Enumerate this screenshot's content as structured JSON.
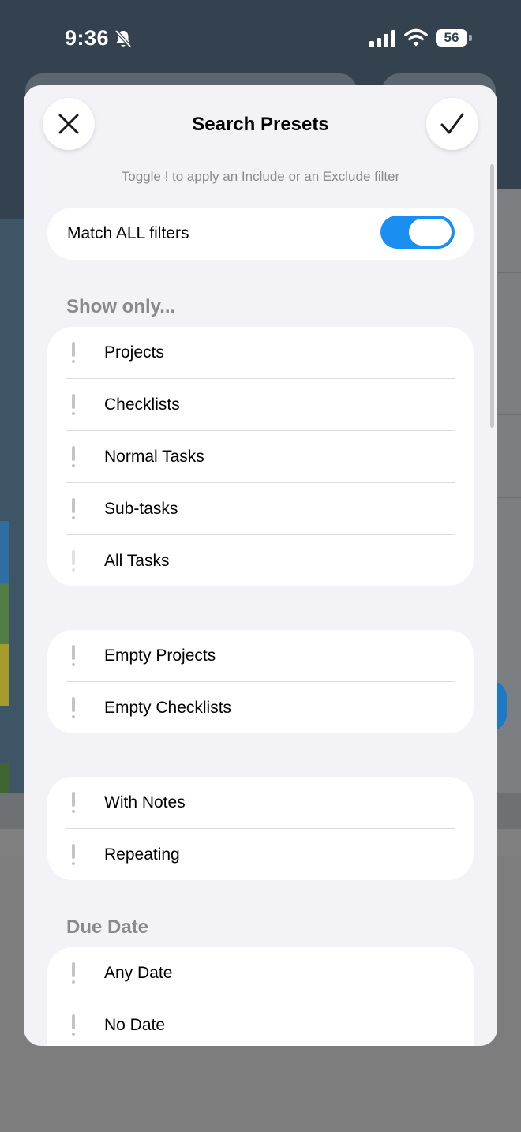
{
  "status_bar": {
    "time": "9:36",
    "battery": "56"
  },
  "sheet": {
    "title": "Search Presets",
    "hint": "Toggle ! to apply an Include or an Exclude filter",
    "match_all": {
      "label": "Match ALL filters",
      "enabled": true
    },
    "sections": {
      "show_only": {
        "header": "Show only...",
        "items": [
          "Projects",
          "Checklists",
          "Normal Tasks",
          "Sub-tasks",
          "All Tasks"
        ]
      },
      "empty": {
        "items": [
          "Empty Projects",
          "Empty Checklists"
        ]
      },
      "attributes": {
        "items": [
          "With Notes",
          "Repeating"
        ]
      },
      "due_date": {
        "header": "Due Date",
        "items": [
          "Any Date",
          "No Date"
        ]
      }
    }
  },
  "colors": {
    "accent": "#1b8ef2",
    "sheet_bg": "#f2f2f7",
    "section_header": "#8a8a8e"
  },
  "icons": {
    "close": "close-icon",
    "confirm": "checkmark-icon",
    "row_toggle": "exclamation-icon"
  }
}
